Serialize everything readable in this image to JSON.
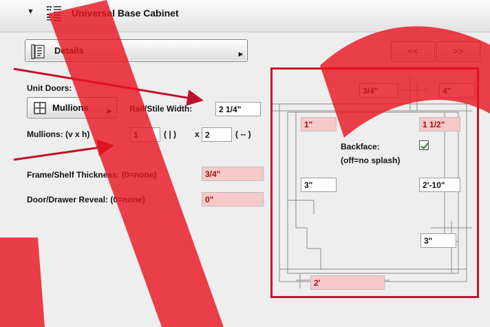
{
  "header": {
    "title": "Universal Base Cabinet"
  },
  "details_button": {
    "label": "Details"
  },
  "nav": {
    "prev_label": "<<",
    "next_label": ">>"
  },
  "unit_doors": {
    "label": "Unit Doors:",
    "mullions_button_label": "Mullions",
    "rail_stile_label": "Rail/Stile Width:",
    "rail_stile_value": "2 1/4\"",
    "mullions_label": "Mullions: (v x h)",
    "mullions_v": "1",
    "mullions_v_symbol": "( | )",
    "times": "x",
    "mullions_h": "2",
    "mullions_h_symbol": "( -- )"
  },
  "frame": {
    "shelf_label": "Frame/Shelf Thickness: (0=none)",
    "shelf_value": "3/4\"",
    "reveal_label": "Door/Drawer Reveal: (0=none)",
    "reveal_value": "0\""
  },
  "diagram": {
    "top_value": "3/4\"",
    "top_right_value": "4\"",
    "left_upper_value": "1\"",
    "right_upper_value": "1 1/2\"",
    "backface_label": "Backface:",
    "backface_note": "(off=no splash)",
    "backface_checked": true,
    "left_mid_value": "3\"",
    "right_mid_value": "2'-10\"",
    "right_lower_value": "3\"",
    "bottom_value": "2'"
  },
  "colors": {
    "highlight_frame": "#c8102e",
    "arrow": "#c0102a",
    "watermark": "#e8121e",
    "pink_field": "#f7c9c9"
  }
}
